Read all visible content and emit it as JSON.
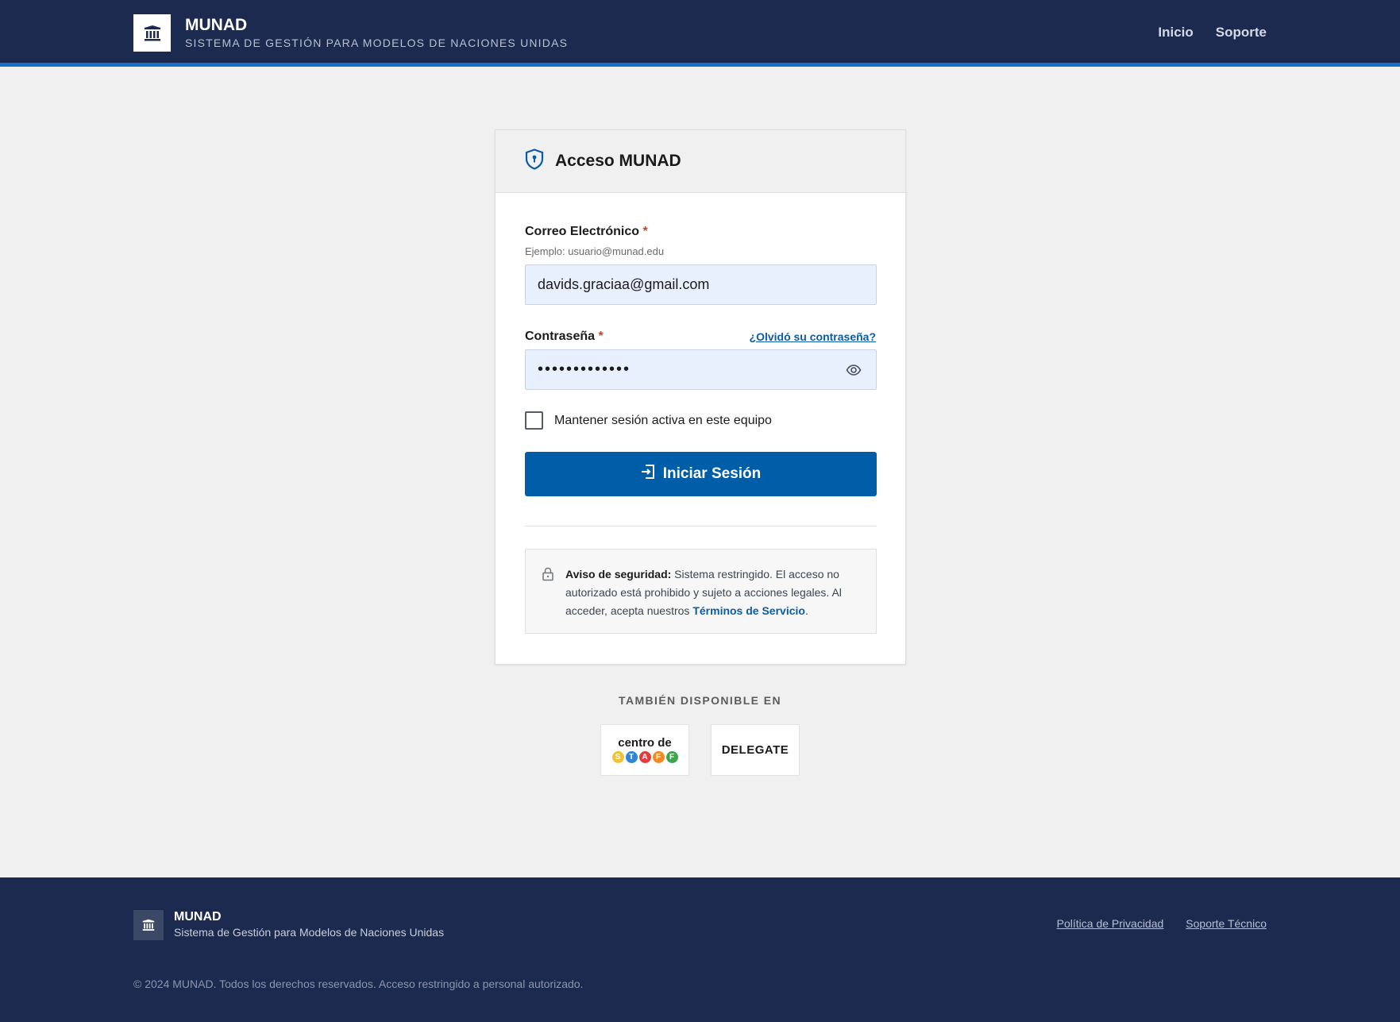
{
  "header": {
    "title": "MUNAD",
    "subtitle": "SISTEMA DE GESTIÓN PARA MODELOS DE NACIONES UNIDAS",
    "nav": [
      "Inicio",
      "Soporte"
    ]
  },
  "card": {
    "title": "Acceso MUNAD",
    "email": {
      "label": "Correo Electrónico",
      "required_mark": "*",
      "hint": "Ejemplo: usuario@munad.edu",
      "value": "davids.graciaa@gmail.com"
    },
    "password": {
      "label": "Contraseña",
      "required_mark": "*",
      "forgot_link": "¿Olvidó su contraseña?",
      "masked_value": "•••••••••••••"
    },
    "remember": {
      "label": "Mantener sesión activa en este equipo",
      "checked": false
    },
    "submit_label": "Iniciar Sesión",
    "notice": {
      "strong": "Aviso de seguridad:",
      "text": " Sistema restringido. El acceso no autorizado está prohibido y sujeto a acciones legales. Al acceder, acepta nuestros ",
      "link": "Términos de Servicio",
      "end": "."
    }
  },
  "also_available": {
    "heading": "TAMBIÉN DISPONIBLE EN",
    "staff": {
      "top": "centro de",
      "letters": [
        "S",
        "T",
        "A",
        "F",
        "F"
      ]
    },
    "delegate": "DELEGATE"
  },
  "footer": {
    "title": "MUNAD",
    "subtitle": "Sistema de Gestión para Modelos de Naciones Unidas",
    "links": [
      "Política de Privacidad",
      "Soporte Técnico"
    ],
    "copyright": "© 2024 MUNAD. Todos los derechos reservados. Acceso restringido a personal autorizado."
  },
  "colors": {
    "header_bg": "#1b2a4e",
    "accent_line": "#1a6fc4",
    "primary_button": "#005ea8",
    "link": "#0b5ca8",
    "required": "#d0421b",
    "input_bg": "#e8f0fe"
  },
  "icons": [
    "institution-icon",
    "shield-icon",
    "eye-icon",
    "sign-in-icon",
    "lock-icon"
  ]
}
